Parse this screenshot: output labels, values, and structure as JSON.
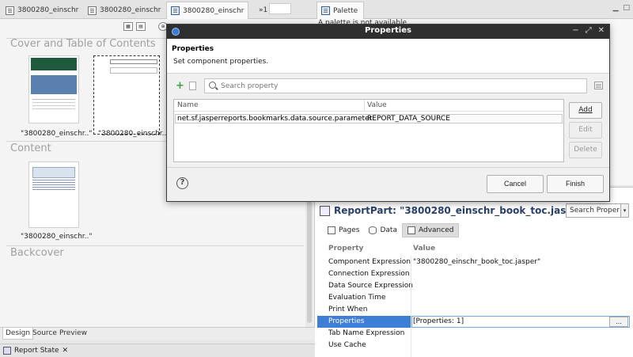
{
  "editor_tabs": [
    {
      "label": "3800280_einschr",
      "active": false
    },
    {
      "label": "3800280_einschr",
      "active": false
    },
    {
      "label": "3800280_einschr",
      "active": true
    },
    {
      "label": "»1",
      "active": false
    }
  ],
  "editor": {
    "sections": {
      "cover": "Cover and Table of Contents",
      "content": "Content",
      "backcover": "Backcover"
    },
    "thumb_labels": {
      "cover1": "\"3800280_einschr..\"",
      "cover2": "\"3800280_einschr..\"",
      "content1": "\"3800280_einschr..\""
    },
    "bottom_tabs": [
      "Design",
      "Source",
      "Preview"
    ]
  },
  "report_state": {
    "label": "Report State"
  },
  "palette": {
    "tab_label": "Palette",
    "message": "A palette is not available"
  },
  "properties_view": {
    "title": "ReportPart: \"3800280_einschr_book_toc.jasp...",
    "search_label": "Search Proper",
    "tabs": [
      "Pages",
      "Data",
      "Advanced"
    ],
    "col_property": "Property",
    "col_value": "Value",
    "rows": [
      {
        "name": "Component Expression",
        "value": "\"3800280_einschr_book_toc.jasper\""
      },
      {
        "name": "Connection Expression",
        "value": ""
      },
      {
        "name": "Data Source Expression",
        "value": ""
      },
      {
        "name": "Evaluation Time",
        "value": ""
      },
      {
        "name": "Print When",
        "value": ""
      },
      {
        "name": "Properties",
        "value": "[Properties: 1]"
      },
      {
        "name": "Tab Name Expression",
        "value": ""
      },
      {
        "name": "Use Cache",
        "value": ""
      }
    ],
    "ellipsis": "..."
  },
  "dialog": {
    "window_title": "Properties",
    "heading": "Properties",
    "subheading": "Set component properties.",
    "search_placeholder": "Search property",
    "col_name": "Name",
    "col_value": "Value",
    "row": {
      "name": "net.sf.jasperreports.bookmarks.data.source.parameter",
      "value": "REPORT_DATA_SOURCE"
    },
    "buttons": {
      "add": "Add",
      "edit": "Edit",
      "delete": "Delete"
    },
    "cancel": "Cancel",
    "finish": "Finish",
    "help": "?"
  }
}
